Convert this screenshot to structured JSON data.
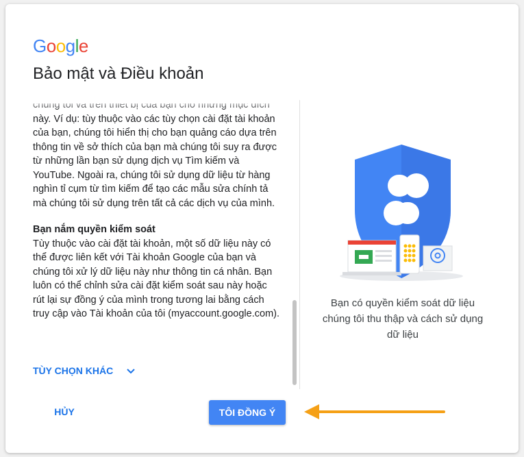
{
  "logo": {
    "letters": [
      "G",
      "o",
      "o",
      "g",
      "l",
      "e"
    ],
    "colors": [
      "#4285F4",
      "#EA4335",
      "#FBBC05",
      "#4285F4",
      "#34A853",
      "#EA4335"
    ]
  },
  "dialog": {
    "title": "Bảo mật và Điều khoản"
  },
  "content": {
    "paragraph1": "chúng tôi và trên thiết bị của bạn cho những mục đích này. Ví dụ: tùy thuộc vào các tùy chọn cài đặt tài khoản của bạn, chúng tôi hiển thị cho bạn quảng cáo dựa trên thông tin về sở thích của bạn mà chúng tôi suy ra được từ những lần bạn sử dụng dịch vụ Tìm kiếm và YouTube. Ngoài ra, chúng tôi sử dụng dữ liệu từ hàng nghìn tỉ cụm từ tìm kiếm để tạo các mẫu sửa chính tả mà chúng tôi sử dụng trên tất cả các dịch vụ của mình.",
    "section_heading": "Bạn nắm quyền kiểm soát",
    "paragraph2": "Tùy thuộc vào cài đặt tài khoản, một số dữ liệu này có thể được liên kết với Tài khoản Google của bạn và chúng tôi xử lý dữ liệu này như thông tin cá nhân. Bạn luôn có thể chỉnh sửa cài đặt kiểm soát sau này hoặc rút lại sự đồng ý của mình trong tương lai bằng cách truy cập vào Tài khoản của tôi (myaccount.google.com)."
  },
  "more_options": {
    "label": "TÙY CHỌN KHÁC",
    "icon": "chevron-down-icon"
  },
  "illustration": {
    "caption": "Bạn có quyền kiểm soát dữ liệu chúng tôi thu thập và cách sử dụng dữ liệu"
  },
  "buttons": {
    "cancel": "HỦY",
    "agree": "TÔI ĐỒNG Ý"
  },
  "colors": {
    "accent": "#1a73e8",
    "button": "#4285f4",
    "arrow": "#f5a016",
    "shield": "#4285f4"
  }
}
